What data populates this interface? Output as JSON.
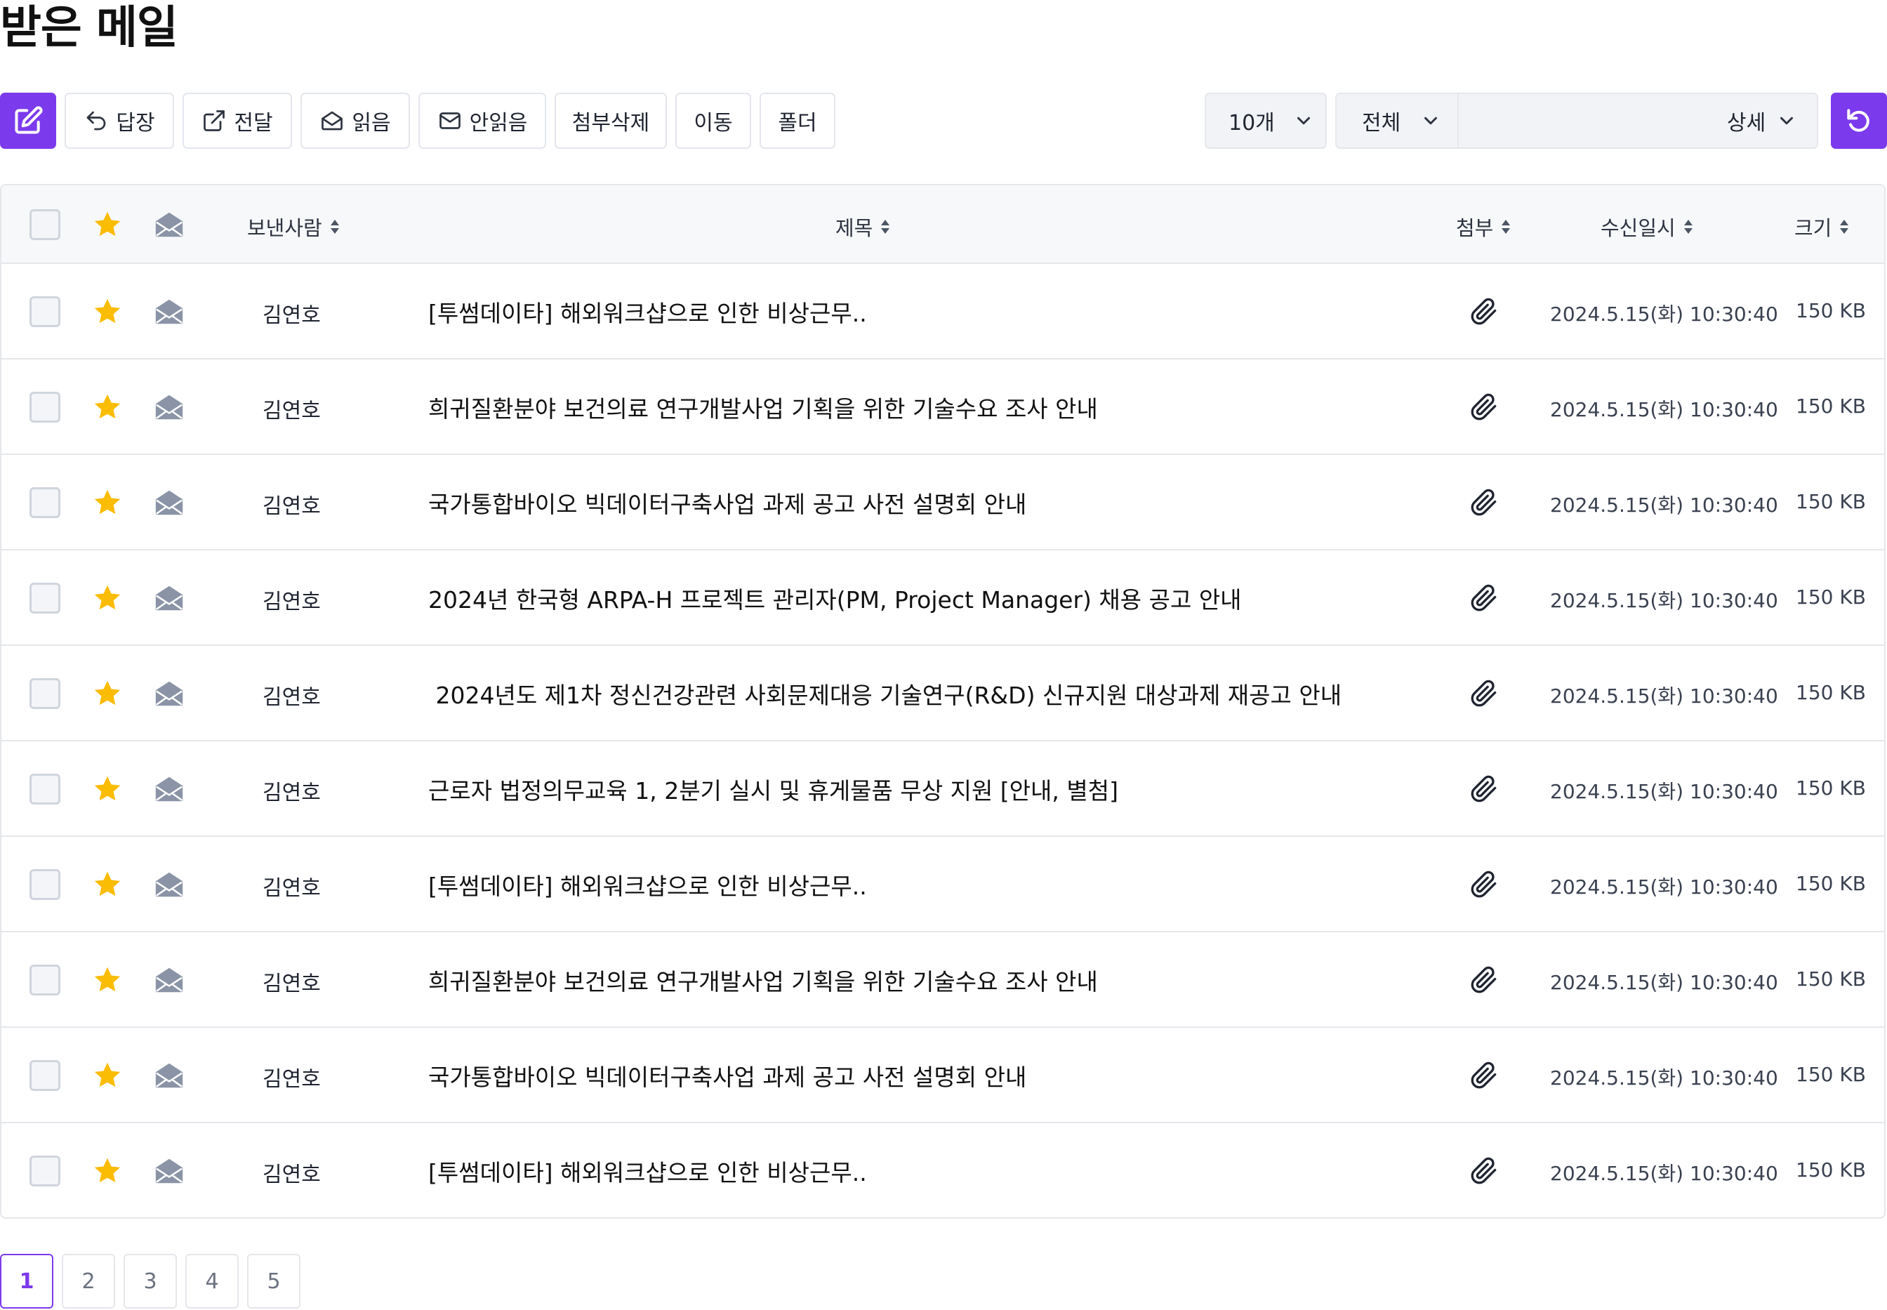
{
  "title": "받은 메일",
  "toolbar": {
    "compose_icon": "edit-icon",
    "buttons": [
      {
        "label": "답장",
        "icon": "reply-icon"
      },
      {
        "label": "전달",
        "icon": "external-link-icon"
      },
      {
        "label": "읽음",
        "icon": "envelope-open-icon"
      },
      {
        "label": "안읽음",
        "icon": "envelope-icon"
      },
      {
        "label": "첨부삭제"
      },
      {
        "label": "이동"
      },
      {
        "label": "폴더"
      }
    ],
    "page_size": "10개",
    "filter": "전체",
    "search_value": "",
    "detail": "상세",
    "refresh_icon": "refresh-icon"
  },
  "columns": {
    "sender": "보낸사람",
    "subject": "제목",
    "attachment": "첨부",
    "received": "수신일시",
    "size": "크기"
  },
  "rows": [
    {
      "sender": "김연호",
      "subject": "[투썸데이타] 해외워크샵으로 인한 비상근무..",
      "received": "2024.5.15(화) 10:30:40",
      "size": "150 KB",
      "starred": true,
      "attachment": true
    },
    {
      "sender": "김연호",
      "subject": "희귀질환분야 보건의료 연구개발사업 기획을 위한 기술수요 조사 안내",
      "received": "2024.5.15(화) 10:30:40",
      "size": "150 KB",
      "starred": true,
      "attachment": true
    },
    {
      "sender": "김연호",
      "subject": "국가통합바이오 빅데이터구축사업 과제 공고 사전 설명회 안내",
      "received": "2024.5.15(화) 10:30:40",
      "size": "150 KB",
      "starred": true,
      "attachment": true
    },
    {
      "sender": "김연호",
      "subject": "2024년 한국형 ARPA-H 프로젝트 관리자(PM, Project Manager) 채용 공고 안내",
      "received": "2024.5.15(화) 10:30:40",
      "size": "150 KB",
      "starred": true,
      "attachment": true
    },
    {
      "sender": "김연호",
      "subject": " 2024년도 제1차 정신건강관련 사회문제대응 기술연구(R&D) 신규지원 대상과제 재공고 안내",
      "received": "2024.5.15(화) 10:30:40",
      "size": "150 KB",
      "starred": true,
      "attachment": true
    },
    {
      "sender": "김연호",
      "subject": "근로자 법정의무교육 1, 2분기 실시 및 휴게물품 무상 지원 [안내, 별첨]",
      "received": "2024.5.15(화) 10:30:40",
      "size": "150 KB",
      "starred": true,
      "attachment": true
    },
    {
      "sender": "김연호",
      "subject": "[투썸데이타] 해외워크샵으로 인한 비상근무..",
      "received": "2024.5.15(화) 10:30:40",
      "size": "150 KB",
      "starred": true,
      "attachment": true
    },
    {
      "sender": "김연호",
      "subject": "희귀질환분야 보건의료 연구개발사업 기획을 위한 기술수요 조사 안내",
      "received": "2024.5.15(화) 10:30:40",
      "size": "150 KB",
      "starred": true,
      "attachment": true
    },
    {
      "sender": "김연호",
      "subject": "국가통합바이오 빅데이터구축사업 과제 공고 사전 설명회 안내",
      "received": "2024.5.15(화) 10:30:40",
      "size": "150 KB",
      "starred": true,
      "attachment": true
    },
    {
      "sender": "김연호",
      "subject": "[투썸데이타] 해외워크샵으로 인한 비상근무..",
      "received": "2024.5.15(화) 10:30:40",
      "size": "150 KB",
      "starred": true,
      "attachment": true
    }
  ],
  "pagination": {
    "pages": [
      "1",
      "2",
      "3",
      "4",
      "5"
    ],
    "current": "1"
  },
  "colors": {
    "accent": "#7c3aed",
    "star": "#fbbc04",
    "envelope": "#8a94a6"
  }
}
